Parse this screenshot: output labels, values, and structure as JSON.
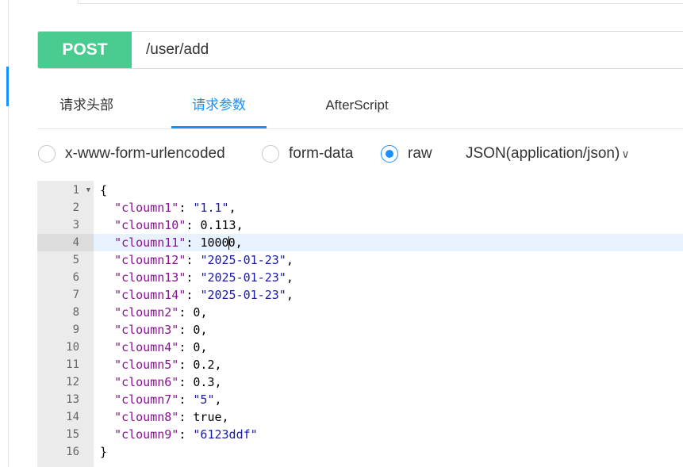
{
  "request": {
    "method": "POST",
    "url": "/user/add"
  },
  "tabs": [
    {
      "label": "请求头部",
      "active": false
    },
    {
      "label": "请求参数",
      "active": true
    },
    {
      "label": "AfterScript",
      "active": false
    }
  ],
  "body_types": [
    {
      "label": "x-www-form-urlencoded",
      "checked": false
    },
    {
      "label": "form-data",
      "checked": false
    },
    {
      "label": "raw",
      "checked": true
    }
  ],
  "content_type": "JSON(application/json)",
  "colors": {
    "accent": "#1890ff",
    "method_bg": "#49cc90",
    "json_key": "#881391",
    "json_string": "#1a1aa6"
  },
  "editor": {
    "active_line": 4,
    "lines": [
      {
        "num": "1",
        "text": "{"
      },
      {
        "num": "2",
        "key": "\"cloumn1\"",
        "value": "\"1.1\"",
        "type": "string",
        "comma": ","
      },
      {
        "num": "3",
        "key": "\"cloumn10\"",
        "value": "0.113",
        "type": "number",
        "comma": ","
      },
      {
        "num": "4",
        "key": "\"cloumn11\"",
        "value": "10000",
        "type": "number",
        "comma": ","
      },
      {
        "num": "5",
        "key": "\"cloumn12\"",
        "value": "\"2025-01-23\"",
        "type": "string",
        "comma": ","
      },
      {
        "num": "6",
        "key": "\"cloumn13\"",
        "value": "\"2025-01-23\"",
        "type": "string",
        "comma": ","
      },
      {
        "num": "7",
        "key": "\"cloumn14\"",
        "value": "\"2025-01-23\"",
        "type": "string",
        "comma": ","
      },
      {
        "num": "8",
        "key": "\"cloumn2\"",
        "value": "0",
        "type": "number",
        "comma": ","
      },
      {
        "num": "9",
        "key": "\"cloumn3\"",
        "value": "0",
        "type": "number",
        "comma": ","
      },
      {
        "num": "10",
        "key": "\"cloumn4\"",
        "value": "0",
        "type": "number",
        "comma": ","
      },
      {
        "num": "11",
        "key": "\"cloumn5\"",
        "value": "0.2",
        "type": "number",
        "comma": ","
      },
      {
        "num": "12",
        "key": "\"cloumn6\"",
        "value": "0.3",
        "type": "number",
        "comma": ","
      },
      {
        "num": "13",
        "key": "\"cloumn7\"",
        "value": "\"5\"",
        "type": "string",
        "comma": ","
      },
      {
        "num": "14",
        "key": "\"cloumn8\"",
        "value": "true",
        "type": "number",
        "comma": ","
      },
      {
        "num": "15",
        "key": "\"cloumn9\"",
        "value": "\"6123ddf\"",
        "type": "string",
        "comma": ""
      },
      {
        "num": "16",
        "text": "}"
      }
    ]
  }
}
